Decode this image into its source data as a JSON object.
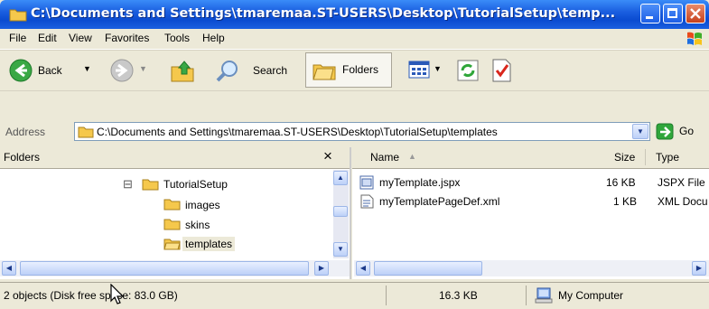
{
  "window": {
    "title": "C:\\Documents and Settings\\tmaremaa.ST-USERS\\Desktop\\TutorialSetup\\temp..."
  },
  "menu": {
    "items": [
      "File",
      "Edit",
      "View",
      "Favorites",
      "Tools",
      "Help"
    ]
  },
  "toolbar": {
    "back_label": "Back",
    "search_label": "Search",
    "folders_label": "Folders"
  },
  "address": {
    "label": "Address",
    "value": "C:\\Documents and Settings\\tmaremaa.ST-USERS\\Desktop\\TutorialSetup\\templates",
    "go_label": "Go"
  },
  "folders_pane": {
    "title": "Folders",
    "close_glyph": "×",
    "tree": {
      "expander": "⊟",
      "root": "TutorialSetup",
      "children": [
        "images",
        "skins",
        "templates"
      ]
    }
  },
  "files_pane": {
    "columns": {
      "name": "Name",
      "size": "Size",
      "type": "Type"
    },
    "rows": [
      {
        "name": "myTemplate.jspx",
        "size": "16 KB",
        "type": "JSPX File"
      },
      {
        "name": "myTemplatePageDef.xml",
        "size": "1 KB",
        "type": "XML Docu"
      }
    ]
  },
  "status": {
    "objects": "2 objects (Disk free space: 83.0 GB)",
    "size": "16.3 KB",
    "location": "My Computer"
  },
  "colors": {
    "titlebar": "#1b5fe0",
    "selected_folder_bg": "#ece9d8",
    "accent_go": "#2fa63a"
  }
}
